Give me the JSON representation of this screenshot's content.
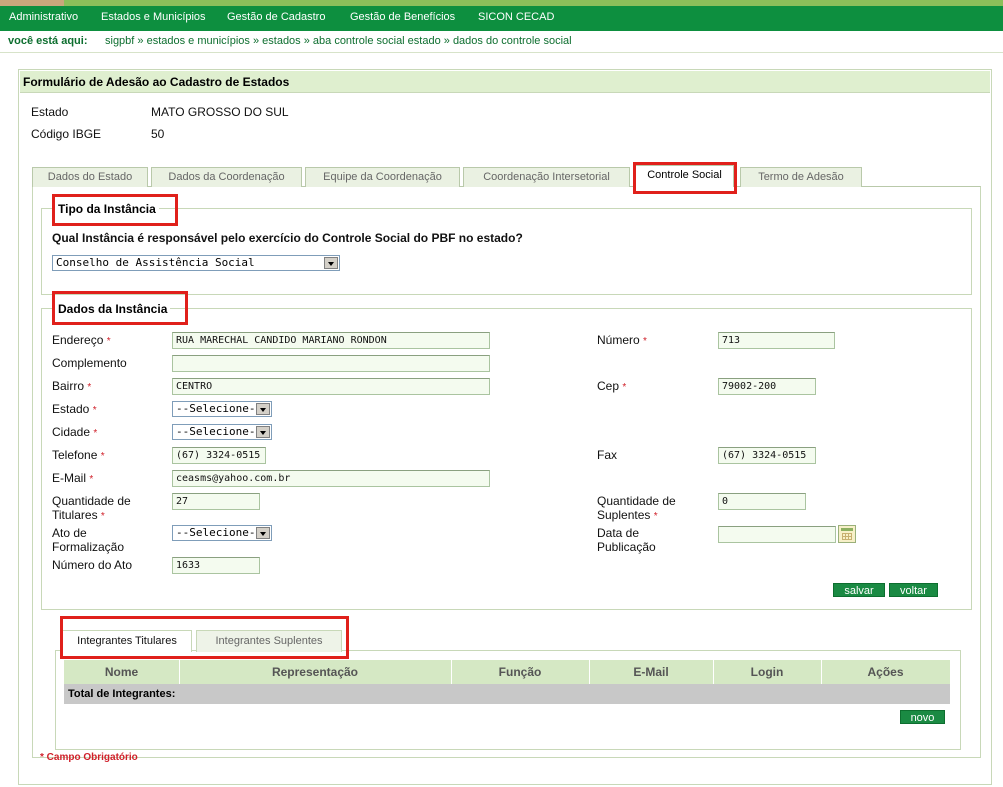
{
  "menu": [
    "Administrativo",
    "Estados e Municípios",
    "Gestão de Cadastro",
    "Gestão de Benefícios",
    "SICON CECAD"
  ],
  "breadcrumb": {
    "label": "você está aqui:",
    "path": "sigpbf » estados e municípios » estados » aba controle social estado » dados do controle social"
  },
  "form": {
    "title": "Formulário de Adesão ao Cadastro de Estados",
    "estado_label": "Estado",
    "estado_value": "MATO GROSSO DO SUL",
    "ibge_label": "Código IBGE",
    "ibge_value": "50"
  },
  "tabs": [
    "Dados do Estado",
    "Dados da Coordenação",
    "Equipe da Coordenação",
    "Coordenação Intersetorial",
    "Controle Social",
    "Termo de Adesão"
  ],
  "active_tab": "Controle Social",
  "tipo": {
    "legend": "Tipo da Instância",
    "question": "Qual Instância é responsável pelo exercício do Controle Social do PBF no estado?",
    "selected": "Conselho de Assistência Social"
  },
  "dados": {
    "legend": "Dados da Instância",
    "required_mark": "*",
    "endereco_label": "Endereço",
    "endereco_value": "RUA MARECHAL CANDIDO MARIANO RONDON",
    "numero_label": "Número",
    "numero_value": "713",
    "complemento_label": "Complemento",
    "complemento_value": "",
    "bairro_label": "Bairro",
    "bairro_value": "CENTRO",
    "cep_label": "Cep",
    "cep_value": "79002-200",
    "estado_label": "Estado",
    "estado_value": "--Selecione--",
    "cidade_label": "Cidade",
    "cidade_value": "--Selecione--",
    "telefone_label": "Telefone",
    "telefone_value": "(67) 3324-0515",
    "fax_label": "Fax",
    "fax_value": "(67) 3324-0515",
    "email_label": "E-Mail",
    "email_value": "ceasms@yahoo.com.br",
    "qtd_titulares_label_1": "Quantidade de",
    "qtd_titulares_label_2": "Titulares",
    "qtd_titulares_value": "27",
    "qtd_suplentes_label_1": "Quantidade de",
    "qtd_suplentes_label_2": "Suplentes",
    "qtd_suplentes_value": "0",
    "ato_label_1": "Ato de",
    "ato_label_2": "Formalização",
    "ato_value": "--Selecione--",
    "data_pub_label_1": "Data de",
    "data_pub_label_2": "Publicação",
    "data_pub_value": "",
    "numero_ato_label": "Número do Ato",
    "numero_ato_value": "1633",
    "salvar": "salvar",
    "voltar": "voltar"
  },
  "integrantes": {
    "tabs": [
      "Integrantes Titulares",
      "Integrantes Suplentes"
    ],
    "columns": [
      "Nome",
      "Representação",
      "Função",
      "E-Mail",
      "Login",
      "Ações"
    ],
    "total_label": "Total de Integrantes:",
    "novo": "novo"
  },
  "footer_required": "* Campo Obrigatório",
  "colors": {
    "menu_bg": "#0d8f3f",
    "header_bg": "#dfefcf",
    "button_bg": "#1a8a43",
    "highlight": "#e0201b",
    "required": "#d0202a"
  }
}
